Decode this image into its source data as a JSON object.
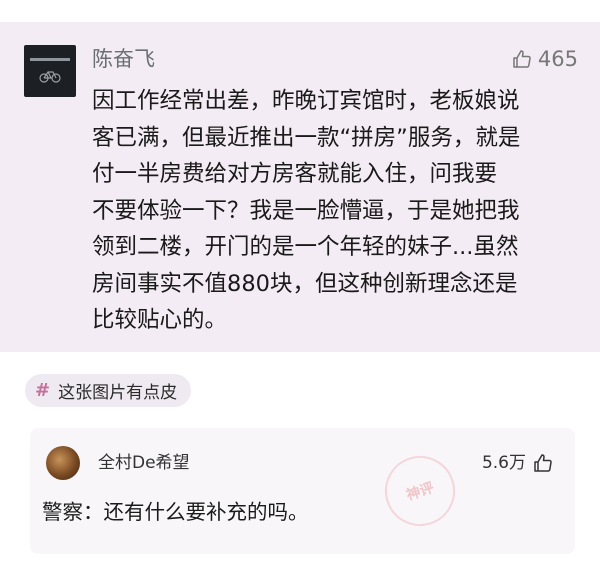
{
  "post": {
    "author": "陈奋飞",
    "likes": "465",
    "lines": [
      "因工作经常出差，昨晚订宾馆时，老板娘说",
      "客已满，但最近推出一款“拼房”服务，就是",
      "付一半房费给对方房客就能入住，问我要",
      "不要体验一下？我是一脸懵逼，于是她把我",
      "领到二楼，开门的是一个年轻的妹子...虽然",
      "房间事实不值880块，但这种创新理念还是",
      "比较贴心的。"
    ]
  },
  "tag": {
    "symbol": "#",
    "text": "这张图片有点皮"
  },
  "comment": {
    "user": "全村De希望",
    "likes": "5.6万",
    "text": "警察：还有什么要补充的吗。"
  },
  "icons": {
    "post_like": "thumbs-up-icon",
    "comment_like": "thumbs-up-icon",
    "avatar1_graphic": "bicycle-icon"
  },
  "colors": {
    "post_background": "#f4ecf4",
    "tag_hash": "#c5709c",
    "comment_background": "#f8f6f9"
  }
}
